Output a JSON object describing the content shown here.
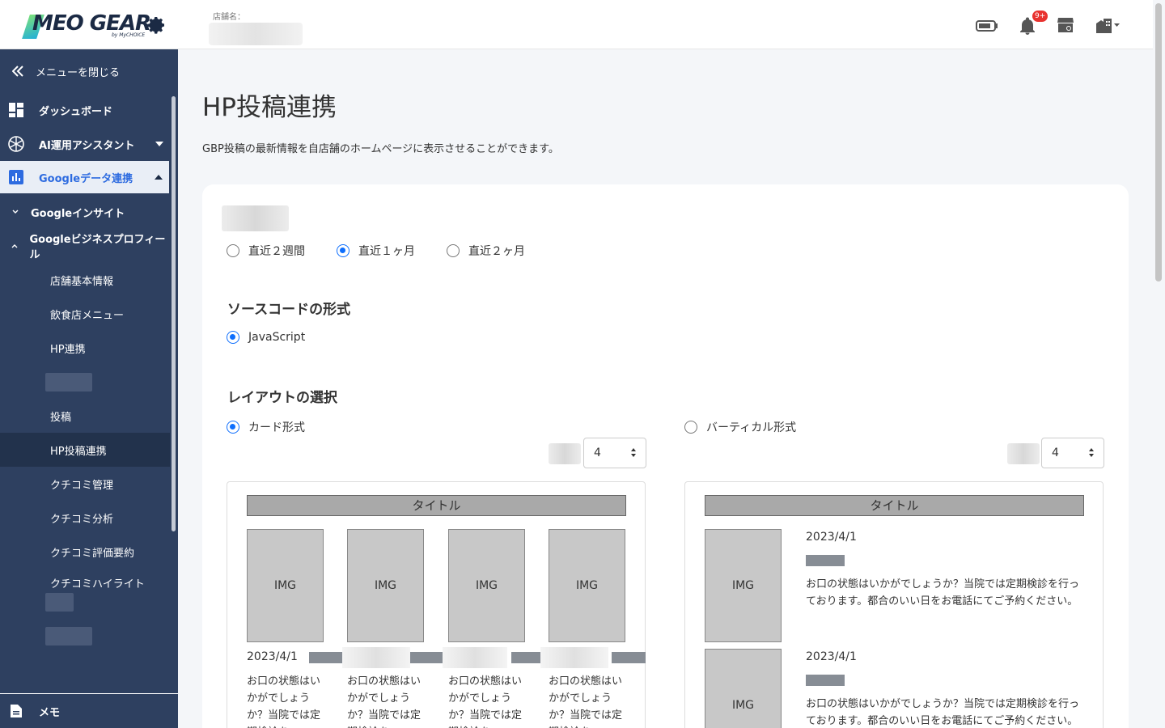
{
  "header": {
    "logo_text": "MEO GEAR",
    "logo_sub": "by MyCHOICE",
    "store_label": "店舗名：",
    "notification_badge": "9+"
  },
  "sidebar": {
    "close_menu": "メニューを閉じる",
    "dashboard": "ダッシュボード",
    "ai_assistant": "AI運用アシスタント",
    "google_data": "Googleデータ連携",
    "google_insight": "Googleインサイト",
    "google_business": "Googleビジネスプロフィール",
    "store_info": "店舗基本情報",
    "restaurant_menu": "飲食店メニュー",
    "hp_link": "HP連携",
    "posts": "投稿",
    "hp_post_link": "HP投稿連携",
    "reviews_manage": "クチコミ管理",
    "reviews_analysis": "クチコミ分析",
    "reviews_summary": "クチコミ評価要約",
    "reviews_highlight": "クチコミハイライト",
    "memo": "メモ"
  },
  "main": {
    "title": "HP投稿連携",
    "description": "GBP投稿の最新情報を自店舗のホームページに表示させることができます。",
    "period_options": [
      "直近２週間",
      "直近１ヶ月",
      "直近２ヶ月"
    ],
    "period_selected": 1,
    "source_heading": "ソースコードの形式",
    "source_option": "JavaScript",
    "layout_heading": "レイアウトの選択",
    "layout_card": "カード形式",
    "layout_vertical": "バーティカル形式",
    "card_count": "4",
    "vertical_count": "4"
  },
  "preview": {
    "title": "タイトル",
    "img": "IMG",
    "date": "2023/4/1",
    "card_text": "お口の状態はいかがでしょうか？当院では定期検診を",
    "vertical_text": "お口の状態はいかがでしょうか？当院では定期検診を行っております。都合のいい日をお電話にてご予約ください。"
  }
}
